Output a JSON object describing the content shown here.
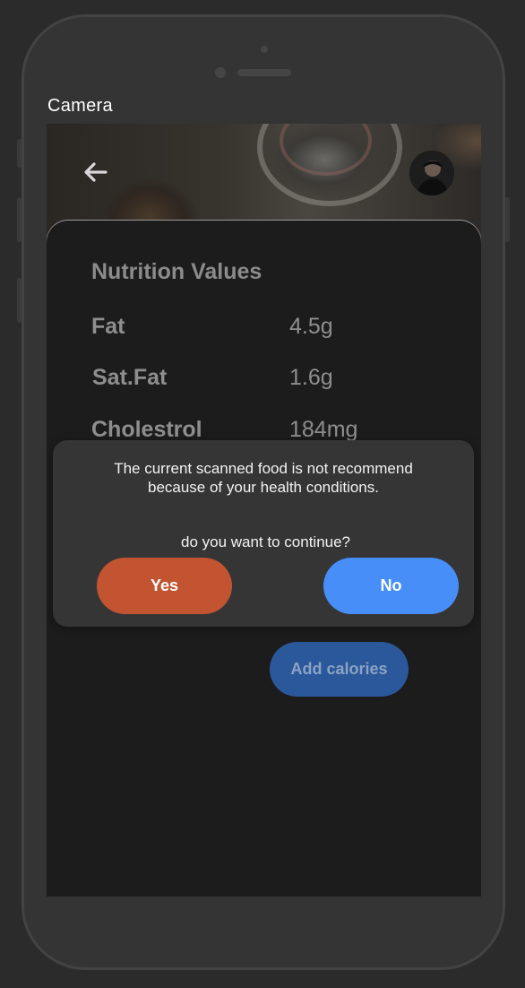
{
  "app": {
    "title": "Camera"
  },
  "nutrition": {
    "title": "Nutrition Values",
    "items": [
      {
        "label": "Fat",
        "value": "4.5g"
      },
      {
        "label": "Sat.Fat",
        "value": "1.6g"
      },
      {
        "label": "Cholestrol",
        "value": "184mg"
      }
    ]
  },
  "actions": {
    "add_calories": "Add calories"
  },
  "dialog": {
    "message": "The current scanned food is not recommend because of your health conditions.",
    "question": "do you want to continue?",
    "yes_label": "Yes",
    "no_label": "No"
  },
  "colors": {
    "yes_button": "#c25432",
    "no_button": "#478ef8",
    "add_calories_button": "#2b589a",
    "background": "#2b2b2b"
  },
  "icons": {
    "back": "arrow-left-icon",
    "avatar": "user-avatar"
  }
}
